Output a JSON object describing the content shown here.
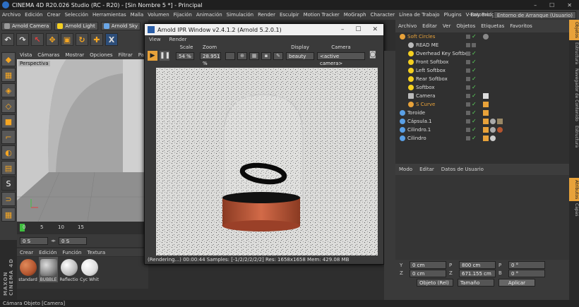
{
  "app": {
    "title": "CINEMA 4D R20.026 Studio (RC - R20) - [Sin Nombre 5 *] - Principal"
  },
  "menubar": {
    "items": [
      "Archivo",
      "Edición",
      "Crear",
      "Selección",
      "Herramientas",
      "Malla",
      "Volumen",
      "Fijación",
      "Animación",
      "Simulación",
      "Render",
      "Esculpir",
      "Motion Tracker",
      "MoGraph",
      "Character",
      "Línea de Trabajo",
      "Plugins",
      "V-Ray Bridge"
    ],
    "entorno_label": "Entorno:",
    "entorno_value": "Entorno de Arranque (Usuario)"
  },
  "toolbar": {
    "arnold_camera": "Arnold Camera",
    "arnold_light": "Arnold Light",
    "arnold_sky": "Arnold Sky",
    "arnold_skydome": "Arnold Sky"
  },
  "viewport": {
    "menu": [
      "Vista",
      "Cámaras",
      "Mostrar",
      "Opciones",
      "Filtrar",
      "Panel"
    ],
    "label": "Perspectiva"
  },
  "timeline": {
    "ticks": [
      "0",
      "5",
      "10",
      "15"
    ],
    "start_field": "0 S",
    "end_field": "0 S"
  },
  "materials": {
    "menu": [
      "Crear",
      "Edición",
      "Función",
      "Textura"
    ],
    "items": [
      {
        "name": "standard",
        "color": "#b4552f"
      },
      {
        "name": "BUBBLE",
        "color": "#888888"
      },
      {
        "name": "Reflectio",
        "color": "#cfcfcf"
      },
      {
        "name": "Cyc Whit",
        "color": "#e8e8e8"
      }
    ]
  },
  "ipr": {
    "title": "Arnold IPR Window v2.4.1.2 (Arnold 5.2.0.1)",
    "menu": [
      "View",
      "Render"
    ],
    "scale_label": "Scale",
    "scale_value": "54 %",
    "zoom_label": "Zoom",
    "zoom_value": "28.951 %",
    "display_label": "Display",
    "display_value": "beauty",
    "camera_label": "Camera",
    "camera_value": "<active camera>",
    "status": "(Rendering...) 00:00:44  Samples: [-1/2/2/2/2/2]  Res: 1658x1658  Mem: 429.08 MB"
  },
  "objects": {
    "menu": [
      "Archivo",
      "Editar",
      "Ver",
      "Objetos",
      "Etiquetas",
      "Favoritos"
    ],
    "rows": [
      {
        "name": "Soft Circles",
        "color": "#e8a23a",
        "indent": 0,
        "highlight": true
      },
      {
        "name": "READ ME",
        "color": "#bbbbbb",
        "indent": 1
      },
      {
        "name": "Overhead Key Softbox",
        "color": "#f5d020",
        "indent": 1
      },
      {
        "name": "Front Softbox",
        "color": "#f5d020",
        "indent": 1
      },
      {
        "name": "Left Softbox",
        "color": "#f5d020",
        "indent": 1
      },
      {
        "name": "Rear Softbox",
        "color": "#f5d020",
        "indent": 1
      },
      {
        "name": "Softbox",
        "color": "#f5d020",
        "indent": 1
      },
      {
        "name": "Camera",
        "color": "#bbbbbb",
        "indent": 1
      },
      {
        "name": "S Curve",
        "color": "#e8a23a",
        "indent": 1,
        "highlight": true
      },
      {
        "name": "Toroide",
        "color": "#5aa0e6",
        "indent": 0
      },
      {
        "name": "Cápsula.1",
        "color": "#5aa0e6",
        "indent": 0
      },
      {
        "name": "Cilindro.1",
        "color": "#5aa0e6",
        "indent": 0
      },
      {
        "name": "Cilindro",
        "color": "#5aa0e6",
        "indent": 0
      }
    ]
  },
  "attributes": {
    "menu": [
      "Modo",
      "Editar",
      "Datos de Usuario"
    ]
  },
  "coords": {
    "rows": [
      {
        "a_label": "Y",
        "a_value": "0 cm",
        "b_label": "P",
        "b_value": "800 cm",
        "c_label": "P",
        "c_value": "0 °"
      },
      {
        "a_label": "Z",
        "a_value": "0 cm",
        "b_label": "Z",
        "b_value": "671.155 cm",
        "c_label": "B",
        "c_value": "0 °"
      }
    ],
    "mode_value": "Objeto (Rel)",
    "size_value": "Tamaño",
    "apply_label": "Aplicar"
  },
  "side_tabs": [
    "Objetos",
    "Estructura",
    "Navegador de Contenido",
    "Estructura",
    "Atributos",
    "Capas"
  ],
  "status_bar": {
    "text": "Cámara Objeto [Camera]"
  },
  "colors": {
    "accent": "#e8a23a",
    "active_green": "#5cd65c"
  }
}
